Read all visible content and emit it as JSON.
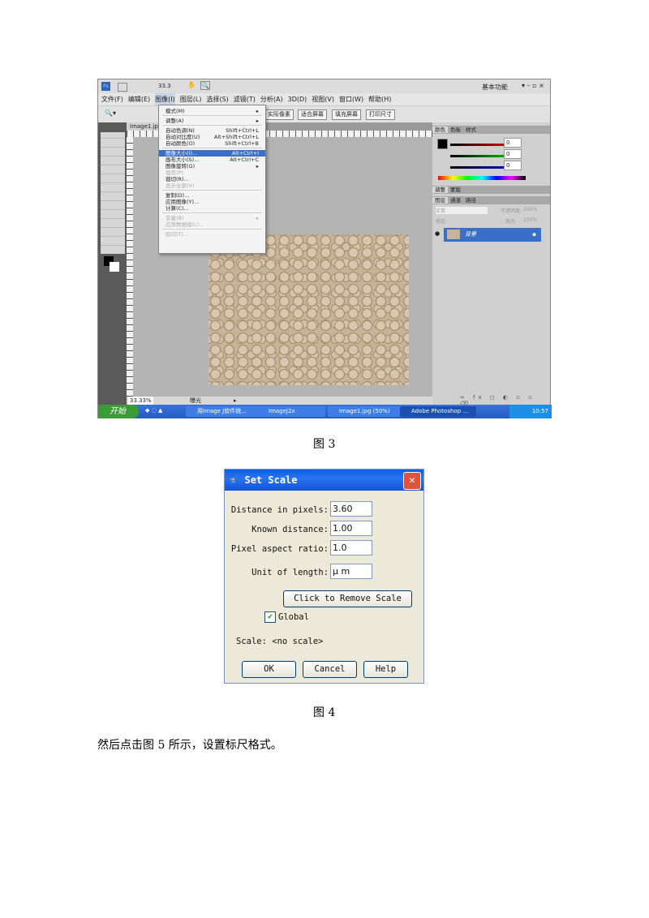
{
  "photoshop": {
    "zoom": "33.3",
    "workspace": "基本功能",
    "menus": [
      "文件(F)",
      "编辑(E)",
      "图像(I)",
      "图层(L)",
      "选择(S)",
      "滤镜(T)",
      "分析(A)",
      "3D(D)",
      "视图(V)",
      "窗口(W)",
      "帮助(H)"
    ],
    "option_buttons": [
      "实际像素",
      "适合屏幕",
      "填充屏幕",
      "打印尺寸"
    ],
    "doc_tab": "Image1.jpg",
    "image_menu": [
      {
        "label": "模式(M)",
        "shortcut": "",
        "submenu": true
      },
      {
        "label": "调整(A)",
        "shortcut": "",
        "submenu": true
      },
      {
        "label": "自动色调(N)",
        "shortcut": "Shift+Ctrl+L"
      },
      {
        "label": "自动对比度(U)",
        "shortcut": "Alt+Shift+Ctrl+L"
      },
      {
        "label": "自动颜色(O)",
        "shortcut": "Shift+Ctrl+B"
      },
      {
        "label": "图像大小(I)...",
        "shortcut": "Alt+Ctrl+I",
        "highlighted": true
      },
      {
        "label": "画布大小(S)...",
        "shortcut": "Alt+Ctrl+C"
      },
      {
        "label": "图像旋转(G)",
        "shortcut": "",
        "submenu": true
      },
      {
        "label": "裁剪(P)",
        "shortcut": "",
        "disabled": true
      },
      {
        "label": "裁切(R)...",
        "shortcut": ""
      },
      {
        "label": "显示全部(V)",
        "shortcut": "",
        "disabled": true
      },
      {
        "label": "复制(D)...",
        "shortcut": ""
      },
      {
        "label": "应用图像(Y)...",
        "shortcut": ""
      },
      {
        "label": "计算(C)...",
        "shortcut": ""
      },
      {
        "label": "变量(B)",
        "shortcut": "",
        "disabled": true,
        "submenu": true
      },
      {
        "label": "应用数据组(L)...",
        "shortcut": "",
        "disabled": true
      },
      {
        "label": "陷印(T)...",
        "shortcut": "",
        "disabled": true
      }
    ],
    "color_panel": {
      "tabs": [
        "颜色",
        "色板",
        "样式"
      ],
      "r": "0",
      "g": "0",
      "b": "0"
    },
    "adjust_tabs": [
      "调整",
      "蒙版"
    ],
    "layers_panel": {
      "tabs": [
        "图层",
        "通道",
        "路径"
      ],
      "blend_mode": "正常",
      "opacity_label": "不透明度:",
      "opacity": "100%",
      "fill_label": "填充:",
      "fill": "100%",
      "lock_label": "锁定:",
      "layer_name": "背景"
    },
    "status": {
      "zoom": "33.33%",
      "label": "曝光"
    },
    "taskbar": {
      "start": "开始",
      "items": [
        "用Image J软件统...",
        "ImageJ2x",
        "Image1.jpg (50%)",
        "Adobe Photoshop ..."
      ],
      "clock": "10:57"
    }
  },
  "caption3": "图 3",
  "dialog": {
    "title": "Set Scale",
    "fields": [
      {
        "label": "Distance in pixels:",
        "value": "3.60"
      },
      {
        "label": "Known distance:",
        "value": "1.00"
      },
      {
        "label": "Pixel aspect ratio:",
        "value": "1.0"
      },
      {
        "label": "Unit of length:",
        "value": "μ m"
      }
    ],
    "remove_scale": "Click to Remove Scale",
    "global_label": "Global",
    "global_checked": true,
    "scale_text": "Scale: <no scale>",
    "ok": "OK",
    "cancel": "Cancel",
    "help": "Help"
  },
  "caption4": "图 4",
  "paragraph": "然后点击图 5 所示，设置标尺格式。"
}
